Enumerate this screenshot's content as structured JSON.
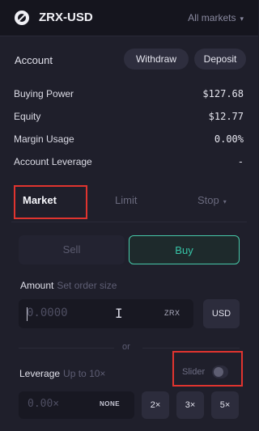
{
  "header": {
    "pair": "ZRX-USD",
    "markets_label": "All markets",
    "markets_chevron": "▾"
  },
  "account": {
    "label": "Account",
    "withdraw": "Withdraw",
    "deposit": "Deposit",
    "rows": [
      {
        "label": "Buying Power",
        "value": "$127.68"
      },
      {
        "label": "Equity",
        "value": "$12.77"
      },
      {
        "label": "Margin Usage",
        "value": "0.00%"
      },
      {
        "label": "Account Leverage",
        "value": "-"
      }
    ]
  },
  "tabs": {
    "market": "Market",
    "limit": "Limit",
    "stop": "Stop",
    "stop_chevron": "▾",
    "active": "Market"
  },
  "side": {
    "sell": "Sell",
    "buy": "Buy",
    "active": "Buy"
  },
  "amount": {
    "label": "Amount",
    "hint": "Set order size",
    "placeholder": "0.0000",
    "unit_tag": "ZRX",
    "toggle": "USD",
    "cursor_glyph": "I"
  },
  "or_text": "or",
  "leverage": {
    "label": "Leverage",
    "hint": "Up to 10×",
    "slider_label": "Slider",
    "slider_on": false,
    "placeholder": "0.00×",
    "none_tag": "NONE",
    "presets": [
      "2×",
      "3×",
      "5×"
    ]
  },
  "colors": {
    "accent": "#47c9a9",
    "highlight_box": "#e0342f",
    "background": "#1f1f2b"
  }
}
